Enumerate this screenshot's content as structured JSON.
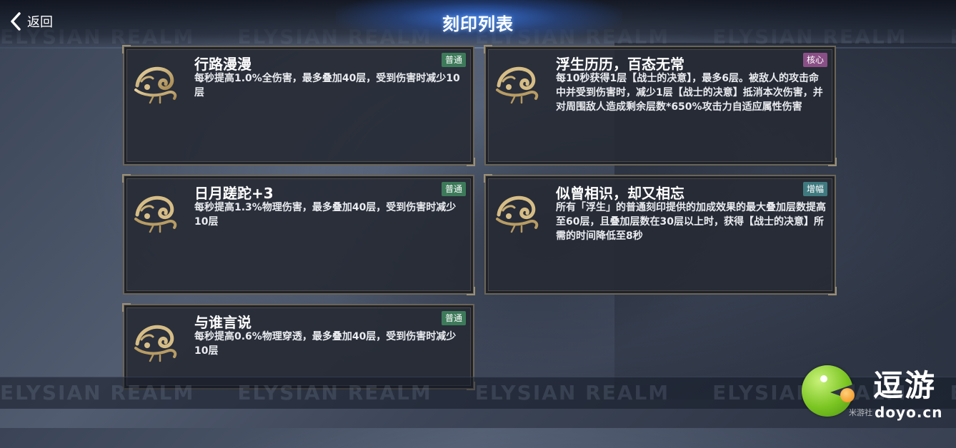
{
  "header": {
    "back_label": "返回",
    "title": "刻印列表",
    "title_glow_color": "#3c82ff"
  },
  "watermark": {
    "text": "ELYSIAN REALM"
  },
  "badge_colors": {
    "普通": "#3d7a5a",
    "核心": "#8a4f86",
    "增幅": "#3f7a80"
  },
  "cards": [
    {
      "title": "行路漫漫",
      "badge": "普通",
      "description": "每秒提高1.0%全伤害，最多叠加40层，受到伤害时减少10层"
    },
    {
      "title": "浮生历历，百态无常",
      "badge": "核心",
      "description": "每10秒获得1层【战士的决意】，最多6层。被敌人的攻击命中并受到伤害时，减少1层【战士的决意】抵消本次伤害，并对周围敌人造成剩余层数*650%攻击力自适应属性伤害"
    },
    {
      "title": "日月蹉跎+3",
      "badge": "普通",
      "description": "每秒提高1.3%物理伤害，最多叠加40层，受到伤害时减少10层"
    },
    {
      "title": "似曾相识，却又相忘",
      "badge": "增幅",
      "description": "所有「浮生」的普通刻印提供的加成效果的最大叠加层数提高至60层，且叠加层数在30层以上时，获得【战士的决意】所需的时间降低至8秒"
    },
    {
      "title": "与谁言说",
      "badge": "普通",
      "description": "每秒提高0.6%物理穿透，最多叠加40层，受到伤害时减少10层"
    }
  ],
  "logo": {
    "cn": "逗游",
    "url": "doyo.cn",
    "sub": "米游社"
  },
  "icons": {
    "back": "chevron-left-icon",
    "emblem": "gold-dragon-emblem-icon"
  }
}
